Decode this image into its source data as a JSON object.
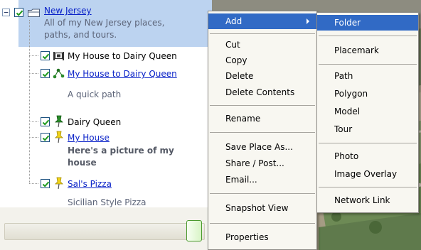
{
  "tree": {
    "root": {
      "label": "New Jersey",
      "description_line1": "All of my New Jersey places,",
      "description_line2": "paths, and tours.",
      "expander_symbol": "−"
    },
    "items": [
      {
        "label": "My House to Dairy Queen",
        "linked": false
      },
      {
        "label": "My House to Dairy Queen",
        "linked": true,
        "description": "A quick path"
      },
      {
        "label": "Dairy Queen",
        "linked": false
      },
      {
        "label": "My House",
        "linked": true,
        "description_line1": "Here's a picture of my",
        "description_line2": "house"
      },
      {
        "label": "Sal's Pizza",
        "linked": true,
        "description": "Sicilian Style Pizza"
      }
    ]
  },
  "context_menu": {
    "items": [
      {
        "label": "Add",
        "highlighted": true,
        "submenu": true
      },
      {
        "label": "Cut"
      },
      {
        "label": "Copy"
      },
      {
        "label": "Delete"
      },
      {
        "label": "Delete Contents"
      },
      {
        "label": "Rename"
      },
      {
        "label": "Save Place As..."
      },
      {
        "label": "Share / Post..."
      },
      {
        "label": "Email..."
      },
      {
        "label": "Snapshot View"
      },
      {
        "label": "Properties"
      }
    ]
  },
  "add_submenu": {
    "items": [
      {
        "label": "Folder",
        "highlighted": true
      },
      {
        "label": "Placemark"
      },
      {
        "label": "Path"
      },
      {
        "label": "Polygon"
      },
      {
        "label": "Model"
      },
      {
        "label": "Tour"
      },
      {
        "label": "Photo"
      },
      {
        "label": "Image Overlay"
      },
      {
        "label": "Network Link"
      }
    ]
  },
  "colors": {
    "selection": "#bcd3f0",
    "menu_highlight": "#316ac5",
    "link": "#0a22c8",
    "check": "#1e9a1e"
  },
  "icons": {
    "root": "folder-icon",
    "tour": "tour-icon",
    "path": "path-icon",
    "pin_green": "green-pushpin-icon",
    "pin_yellow": "yellow-pushpin-icon"
  }
}
